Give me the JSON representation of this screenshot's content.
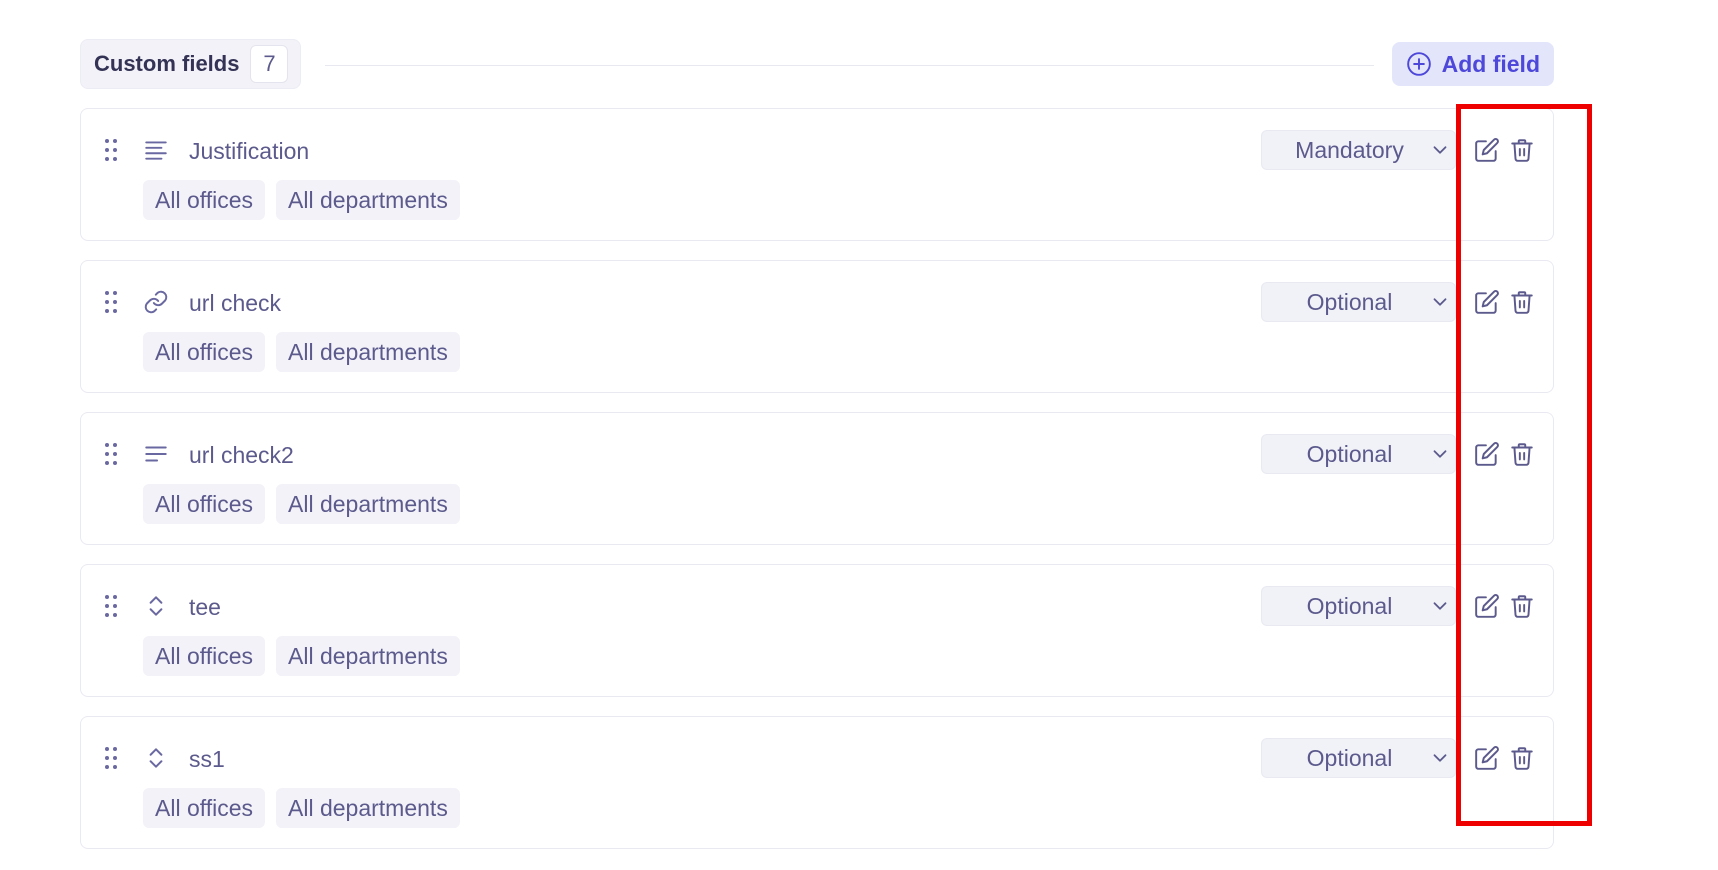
{
  "section": {
    "title": "Custom fields",
    "count": "7",
    "add_button_label": "Add field"
  },
  "fields": [
    {
      "name": "Justification",
      "type_icon": "paragraph-icon",
      "requirement": "Mandatory",
      "tags": [
        "All offices",
        "All departments"
      ]
    },
    {
      "name": "url check",
      "type_icon": "link-icon",
      "requirement": "Optional",
      "tags": [
        "All offices",
        "All departments"
      ]
    },
    {
      "name": "url check2",
      "type_icon": "text-lines-icon",
      "requirement": "Optional",
      "tags": [
        "All offices",
        "All departments"
      ]
    },
    {
      "name": "tee",
      "type_icon": "select-chevrons-icon",
      "requirement": "Optional",
      "tags": [
        "All offices",
        "All departments"
      ]
    },
    {
      "name": "ss1",
      "type_icon": "select-chevrons-icon",
      "requirement": "Optional",
      "tags": [
        "All offices",
        "All departments"
      ]
    }
  ],
  "colors": {
    "accent": "#4d48d9",
    "accent_bg": "#e3e5fb",
    "text": "#5c5a8c",
    "title": "#343356",
    "highlight": "#ee0000"
  }
}
